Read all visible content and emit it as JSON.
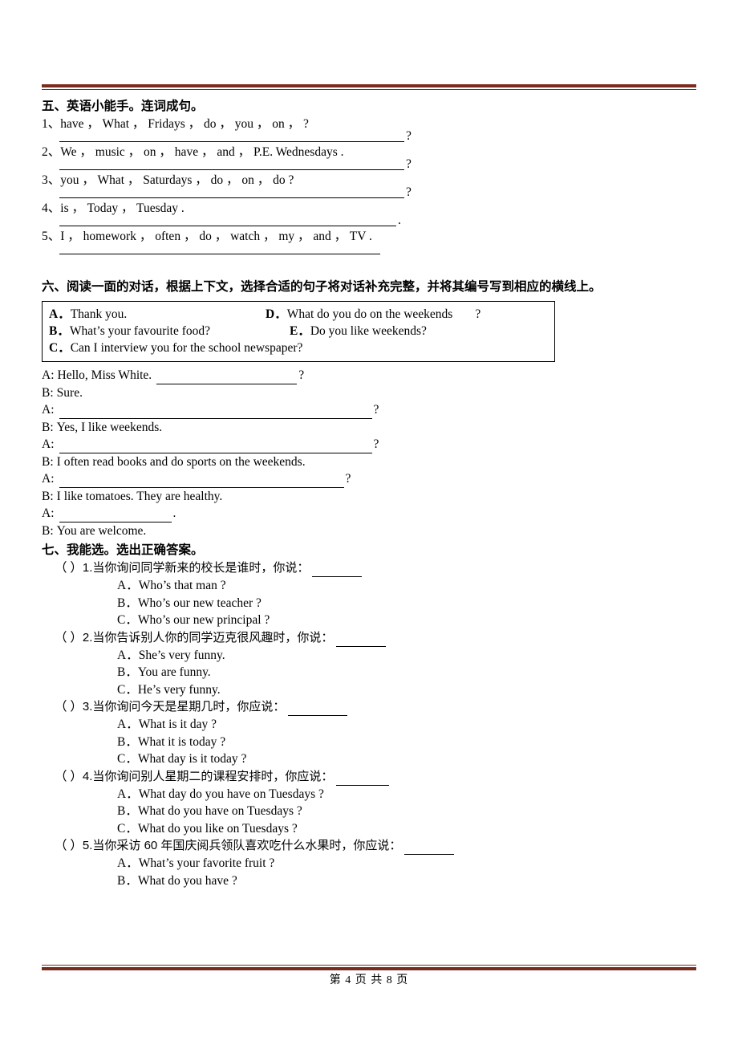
{
  "section5": {
    "heading": "五、英语小能手。连词成句。",
    "items": [
      {
        "num": "1、",
        "text": "have ，  What ，   Fridays ，   do ，   you ，  on ，   ?",
        "rule_width": 430,
        "tail": "?"
      },
      {
        "num": "2、",
        "text": "We ，  music ，   on ，   have ，   and ，   P.E.      Wednesdays   .",
        "rule_width": 430,
        "tail": "?"
      },
      {
        "num": "3、",
        "text": "you ，  What ，   Saturdays ，   do ，   on ，   do  ?",
        "rule_width": 430,
        "tail": "?"
      },
      {
        "num": "4、",
        "text": "is ，   Today ，   Tuesday   .",
        "rule_width": 420,
        "tail": "."
      },
      {
        "num": "5、",
        "text": "I ，   homework ，   often ，   do ，   watch ，   my ，   and ，   TV .",
        "rule_width": 400,
        "tail": ""
      }
    ]
  },
  "section6": {
    "heading": "六、阅读一面的对话，根据上下文，选择合适的句子将对话补充完整，并将其编号写到相应的横线上。",
    "choices": [
      {
        "letter": "A．",
        "text": "Thank you."
      },
      {
        "letter": "D．",
        "text": "What do you do on the weekends",
        "tail": "?"
      },
      {
        "letter": "B．",
        "text": "What’s your favourite food?"
      },
      {
        "letter": "E．",
        "text": "Do you like weekends?"
      },
      {
        "letter": "C．",
        "text": "Can I interview you for the school newspaper?"
      }
    ],
    "dialogue": [
      {
        "label": "A:",
        "text": "Hello, Miss White.",
        "rule_width": 175,
        "tail": "?"
      },
      {
        "label": "B:",
        "text": "Sure.",
        "rule_width": 0,
        "tail": ""
      },
      {
        "label": "A:",
        "text": "",
        "rule_width": 390,
        "tail": "?"
      },
      {
        "label": "B:",
        "text": "Yes, I like weekends.",
        "rule_width": 0,
        "tail": ""
      },
      {
        "label": "A:",
        "text": "",
        "rule_width": 390,
        "tail": "?"
      },
      {
        "label": "B:",
        "text": "I often read books and do sports on the weekends.",
        "rule_width": 0,
        "tail": ""
      },
      {
        "label": "A:",
        "text": "",
        "rule_width": 355,
        "tail": "?"
      },
      {
        "label": "B:",
        "text": "I like tomatoes. They are healthy.",
        "rule_width": 0,
        "tail": ""
      },
      {
        "label": "A:",
        "text": "",
        "rule_width": 140,
        "tail": "."
      },
      {
        "label": "B:",
        "text": "You are welcome.",
        "rule_width": 0,
        "tail": ""
      }
    ]
  },
  "section7": {
    "heading": "七、我能选。选出正确答案。",
    "questions": [
      {
        "paren": "（          ）",
        "stem": "1.当你询问同学新来的校长是谁时，你说：",
        "blank_width": 62,
        "options": [
          "A．Who’s that man ?",
          "B．Who’s our new teacher ?",
          "C．Who’s our new principal ?"
        ]
      },
      {
        "paren": "（          ）",
        "stem": "2.当你告诉别人你的同学迈克很风趣时，你说：",
        "blank_width": 62,
        "options": [
          "A．She’s very funny.",
          "B．You are funny.",
          "C．He’s very funny."
        ]
      },
      {
        "paren": "（          ）",
        "stem": "3.当你询问今天是星期几时，你应说：",
        "blank_width": 74,
        "options": [
          "A．What is it day ?",
          "B．What it is today ?",
          "C．What day is it today ?"
        ]
      },
      {
        "paren": "（          ）",
        "stem": "4.当你询问别人星期二的课程安排时，你应说：",
        "blank_width": 66,
        "options": [
          "A．What day do you have on Tuesdays ?",
          "B．What do you have on Tuesdays ?",
          "C．What do you like on Tuesdays ?"
        ]
      },
      {
        "paren": "（          ）",
        "stem": "5.当你采访 60 年国庆阅兵领队喜欢吃什么水果时，你应说：",
        "blank_width": 62,
        "options": [
          "A．What’s your favorite fruit ?",
          "B．What do you have ?"
        ]
      }
    ]
  },
  "footer": {
    "text": "第 4 页 共 8 页"
  },
  "colors": {
    "rule": "#7b2a1e"
  }
}
